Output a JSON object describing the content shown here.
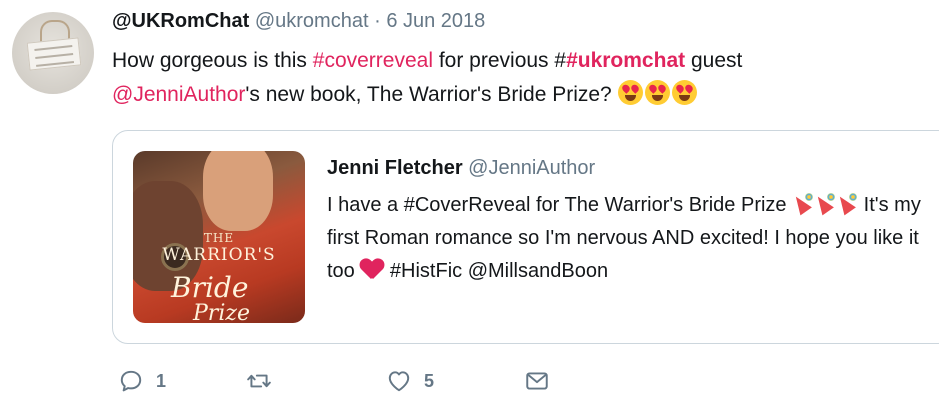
{
  "tweet": {
    "author_name": "@UKRomChat",
    "author_handle": "@ukromchat",
    "separator": "·",
    "date": "6 Jun 2018",
    "text_part1": "How gorgeous is this ",
    "hashtag_coverreveal": "#coverreveal",
    "text_part2": " for previous #",
    "hashtag_ukromchat": "#ukromchat",
    "text_part3": " guest",
    "mention": "@JenniAuthor",
    "text_part4": "'s new book, The Warrior's Bride Prize? ",
    "emoji_name": "heart-eyes-emoji"
  },
  "quoted": {
    "author_name": "Jenni Fletcher",
    "author_handle": "@JenniAuthor",
    "text_part1": "I have a #CoverReveal for The Warrior's Bride Prize ",
    "text_part2": " It's my first Roman romance so I'm nervous AND excited! I hope you like it too ",
    "text_part3": " #HistFic @MillsandBoon",
    "cover": {
      "line1": "THE",
      "line2": "WARRIOR'S",
      "line3": "Bride",
      "line4": "Prize"
    }
  },
  "actions": {
    "reply_count": "1",
    "retweet_count": "",
    "like_count": "5",
    "icons": [
      "reply-icon",
      "retweet-icon",
      "like-icon",
      "message-icon"
    ]
  },
  "colors": {
    "accent_pink": "#e0245e",
    "secondary_text": "#657786",
    "border": "#ccd6dd"
  }
}
